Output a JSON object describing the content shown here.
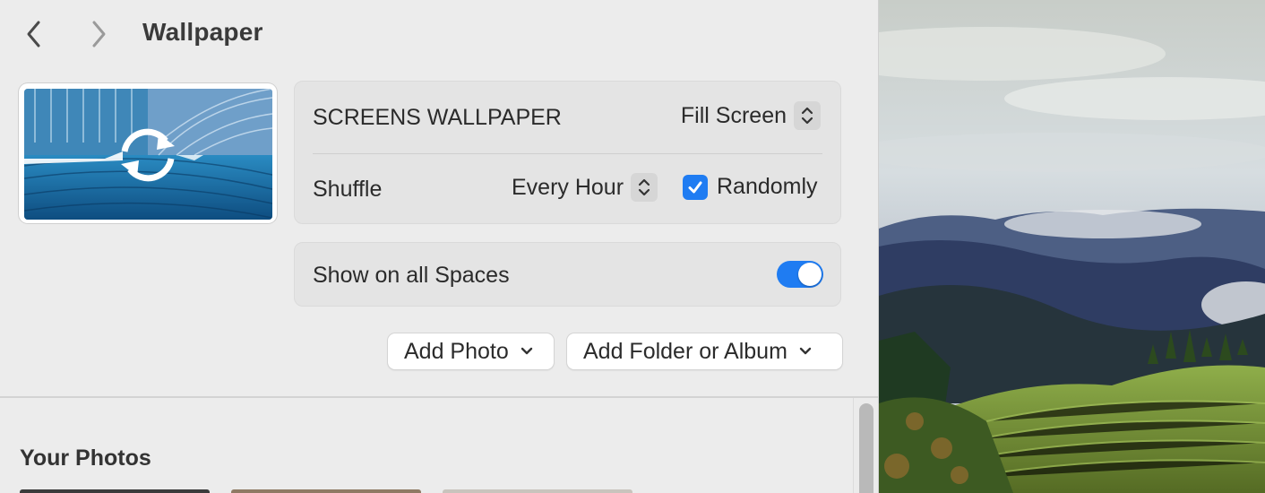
{
  "header": {
    "title": "Wallpaper"
  },
  "settings": {
    "screens_label": "SCREENS WALLPAPER",
    "fill_mode": "Fill Screen",
    "shuffle_label": "Shuffle",
    "shuffle_interval": "Every Hour",
    "randomly_label": "Randomly",
    "randomly_checked": true,
    "spaces_label": "Show on all Spaces",
    "spaces_enabled": true
  },
  "buttons": {
    "add_photo": "Add Photo",
    "add_folder": "Add Folder or Album"
  },
  "section": {
    "title": "Your Photos"
  },
  "colors": {
    "accent": "#1f7cf2",
    "pane_bg": "#ececec",
    "group_bg": "#e4e4e4"
  }
}
